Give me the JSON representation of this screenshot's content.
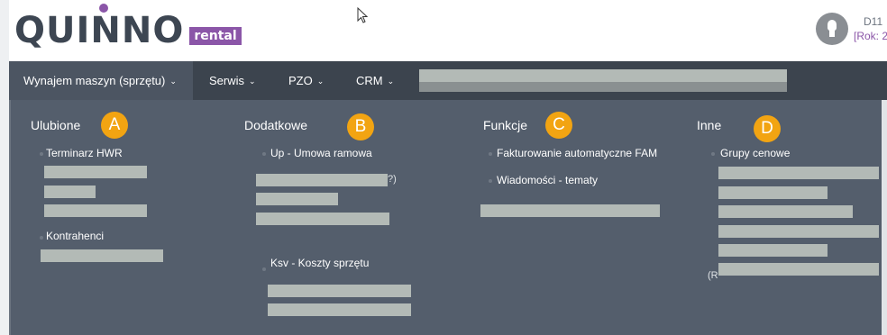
{
  "header": {
    "logo_text": "QUINNO",
    "logo_badge": "rental",
    "user_id": "D11",
    "user_year": "[Rok: 2",
    "icons": {
      "cursor": "mouse-pointer-icon",
      "avatar": "user-avatar-icon"
    }
  },
  "nav": {
    "items": [
      {
        "label": "Wynajem maszyn (sprzętu)",
        "chevron": "⌄"
      },
      {
        "label": "Serwis",
        "chevron": "⌄"
      },
      {
        "label": "PZO",
        "chevron": "⌄"
      },
      {
        "label": "CRM",
        "chevron": "⌄"
      }
    ]
  },
  "menu": {
    "columns": [
      {
        "title": "Ulubione",
        "badge": "A",
        "items": [
          "Terminarz HWR",
          "Kontrahenci"
        ]
      },
      {
        "title": "Dodatkowe",
        "badge": "B",
        "items": [
          "Up - Umowa ramowa",
          "Ksv - Koszty sprzętu"
        ],
        "fragment": "?)"
      },
      {
        "title": "Funkcje",
        "badge": "C",
        "items": [
          "Fakturowanie automatyczne FAM",
          "Wiadomości - tematy"
        ]
      },
      {
        "title": "Inne",
        "badge": "D",
        "items": [
          "Grupy cenowe"
        ],
        "fragment": "(R"
      }
    ]
  },
  "colors": {
    "nav_background": "#3c444e",
    "menu_background": "#545e6c",
    "brand_purple": "#8b56a8",
    "badge_orange": "#f2a412",
    "redaction": "#b3bab6"
  }
}
